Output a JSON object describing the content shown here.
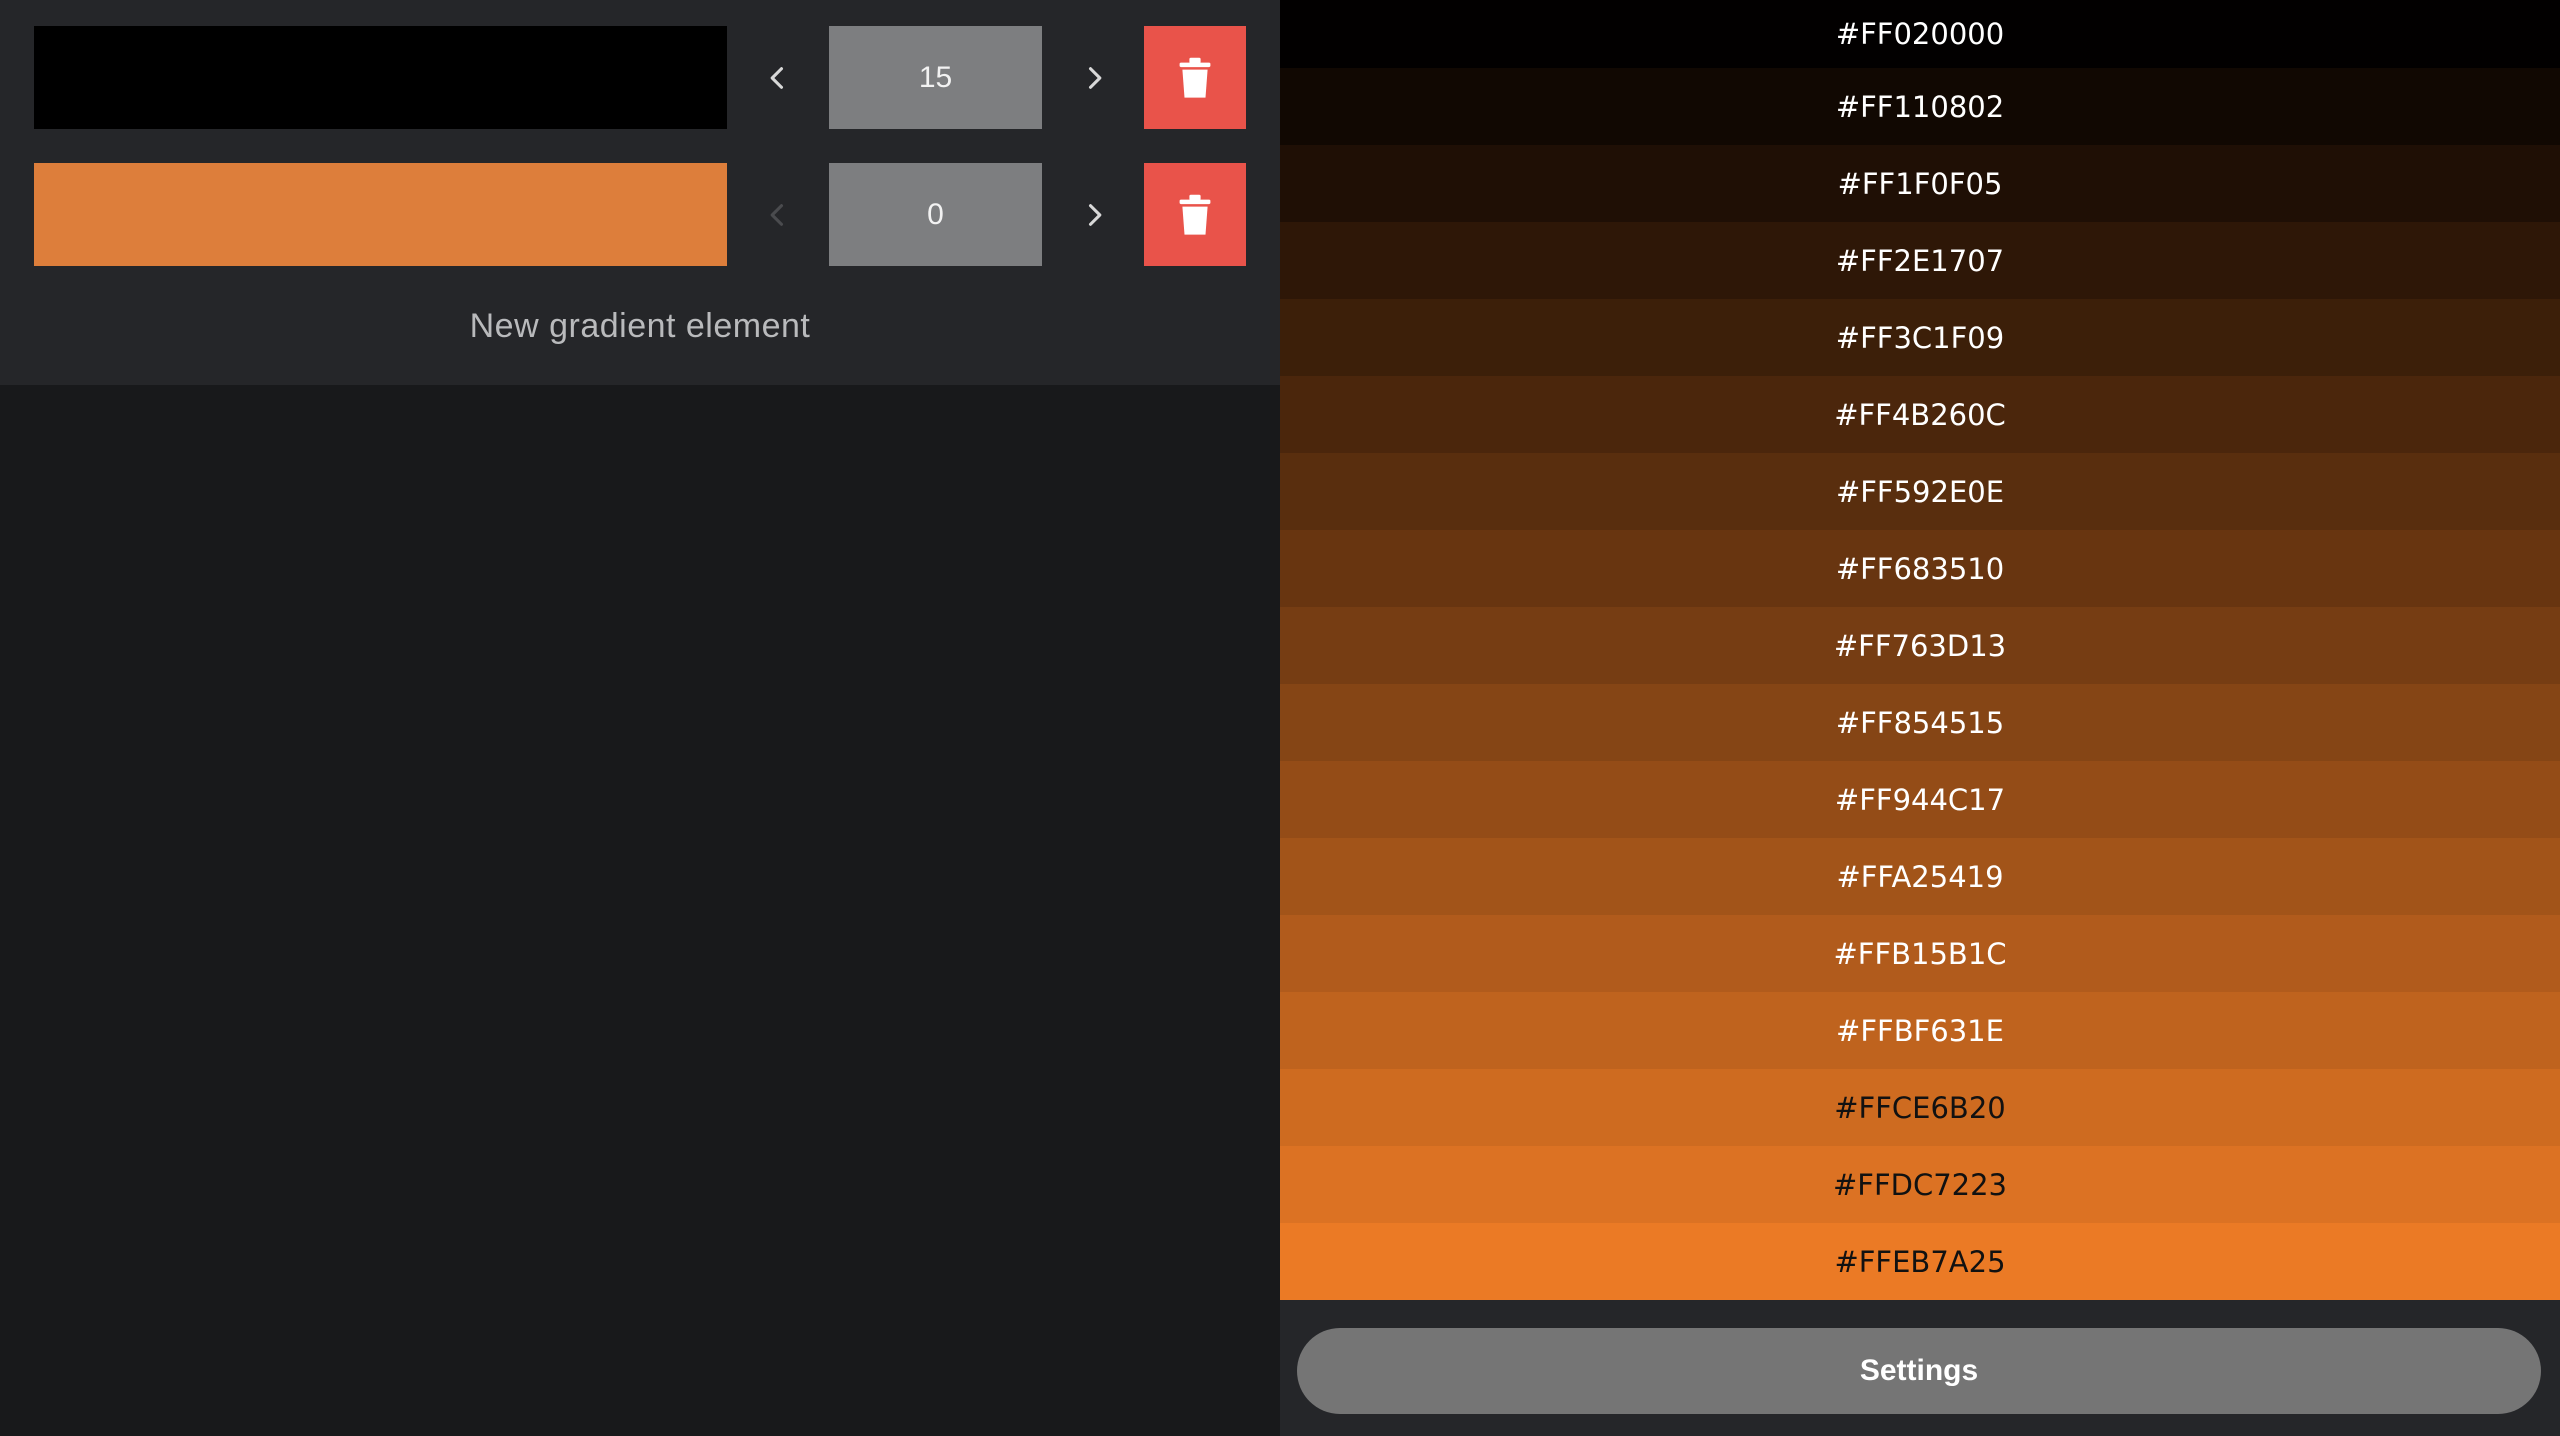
{
  "editor": {
    "stops": [
      {
        "color": "#000000",
        "position": "15",
        "left_disabled": false
      },
      {
        "color": "#DD7E3B",
        "position": "0",
        "left_disabled": true
      }
    ],
    "new_element_label": "New gradient element"
  },
  "palette": {
    "rows": [
      {
        "label": "#FF020000",
        "bg": "#020000",
        "fg": "#ffffff"
      },
      {
        "label": "#FF110802",
        "bg": "#110802",
        "fg": "#ffffff"
      },
      {
        "label": "#FF1F0F05",
        "bg": "#1F0F05",
        "fg": "#ffffff"
      },
      {
        "label": "#FF2E1707",
        "bg": "#2E1707",
        "fg": "#ffffff"
      },
      {
        "label": "#FF3C1F09",
        "bg": "#3C1F09",
        "fg": "#ffffff"
      },
      {
        "label": "#FF4B260C",
        "bg": "#4B260C",
        "fg": "#ffffff"
      },
      {
        "label": "#FF592E0E",
        "bg": "#592E0E",
        "fg": "#ffffff"
      },
      {
        "label": "#FF683510",
        "bg": "#683510",
        "fg": "#ffffff"
      },
      {
        "label": "#FF763D13",
        "bg": "#763D13",
        "fg": "#ffffff"
      },
      {
        "label": "#FF854515",
        "bg": "#854515",
        "fg": "#ffffff"
      },
      {
        "label": "#FF944C17",
        "bg": "#944C17",
        "fg": "#ffffff"
      },
      {
        "label": "#FFA25419",
        "bg": "#A25419",
        "fg": "#ffffff"
      },
      {
        "label": "#FFB15B1C",
        "bg": "#B15B1C",
        "fg": "#ffffff"
      },
      {
        "label": "#FFBF631E",
        "bg": "#BF631E",
        "fg": "#ffffff"
      },
      {
        "label": "#FFCE6B20",
        "bg": "#CE6B20",
        "fg": "#111111"
      },
      {
        "label": "#FFDC7223",
        "bg": "#DC7223",
        "fg": "#111111"
      },
      {
        "label": "#FFEB7A25",
        "bg": "#EB7A25",
        "fg": "#111111"
      }
    ]
  },
  "settings_label": "Settings",
  "colors": {
    "delete_red": "#E9534A",
    "field_gray": "#7D7E80",
    "panel_dark": "#252629",
    "background": "#18191B"
  },
  "icons": {
    "decrease": "chevron-left-icon",
    "increase": "chevron-right-icon",
    "delete": "trash-icon"
  }
}
